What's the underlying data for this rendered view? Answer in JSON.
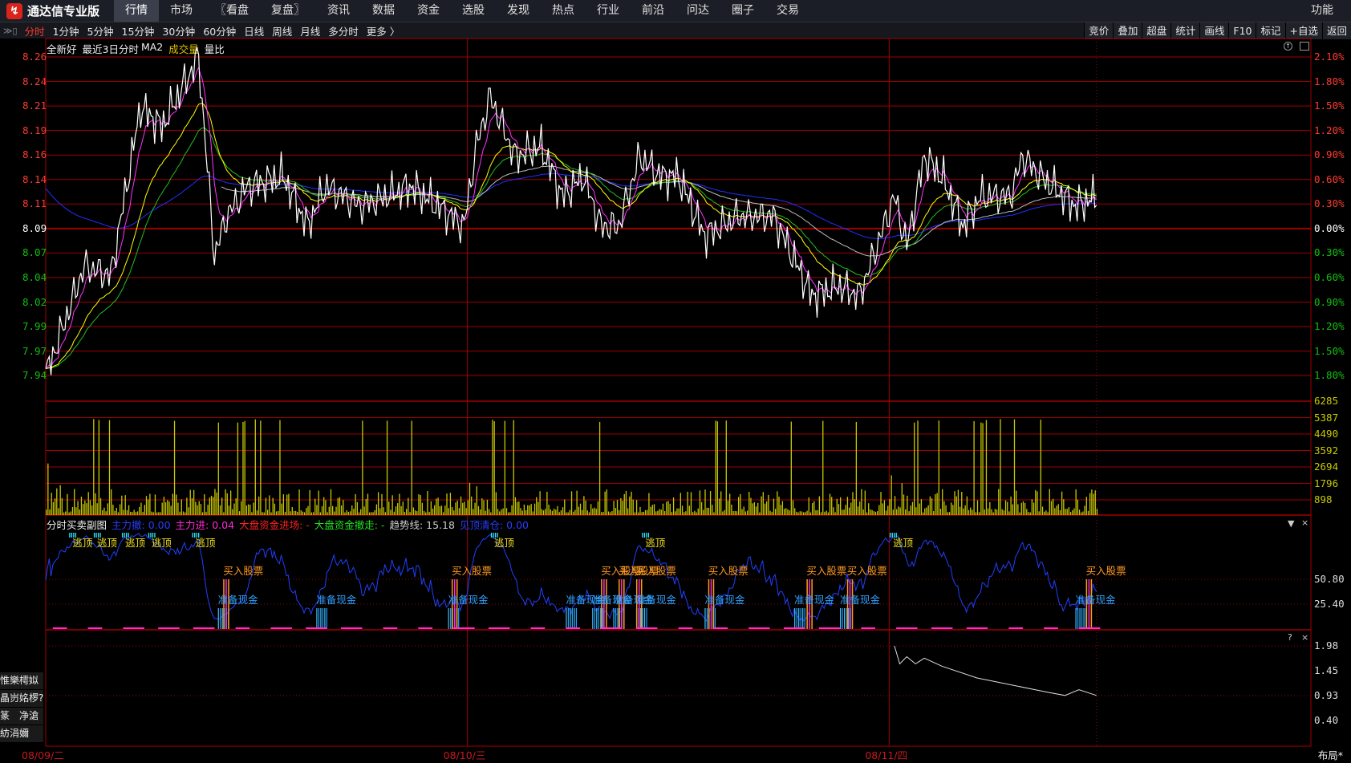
{
  "app": {
    "name": "通达信专业版",
    "logo_icon": "tdx-logo-icon"
  },
  "menu": {
    "items": [
      "行情",
      "市场",
      "〖看盘",
      "复盘〗",
      "资讯",
      "数据",
      "资金",
      "选股",
      "发现",
      "热点",
      "行业",
      "前沿",
      "问达",
      "圈子",
      "交易"
    ],
    "active": 0,
    "right": "功能"
  },
  "toolbar": {
    "timeframes": [
      "分时",
      "1分钟",
      "5分钟",
      "15分钟",
      "30分钟",
      "60分钟",
      "日线",
      "周线",
      "月线",
      "多分时",
      "更多 〉"
    ],
    "active": 0,
    "buttons": [
      "竞价",
      "叠加",
      "超盘",
      "统计",
      "画线",
      "F10",
      "标记",
      "+自选",
      "返回"
    ]
  },
  "info": {
    "stock": "全新好",
    "mode": "最近3日分时",
    "ma": "MA2",
    "volume": "成交量",
    "ratio": "量比"
  },
  "price_axis": {
    "left": [
      "8.26",
      "8.24",
      "8.21",
      "8.19",
      "8.16",
      "8.14",
      "8.11",
      "8.09",
      "8.07",
      "8.04",
      "8.02",
      "7.99",
      "7.97",
      "7.94"
    ],
    "right": [
      "2.10%",
      "1.80%",
      "1.50%",
      "1.20%",
      "0.90%",
      "0.60%",
      "0.30%",
      "0.00%",
      "0.30%",
      "0.60%",
      "0.90%",
      "1.20%",
      "1.50%",
      "1.80%"
    ],
    "prev_close": 8.09,
    "max": 8.26,
    "min": 7.94
  },
  "volume_axis": [
    "6285",
    "5387",
    "4490",
    "3592",
    "2694",
    "1796",
    "898"
  ],
  "indicator": {
    "title": "分时买卖副图",
    "fields": [
      {
        "label": "主力撤:",
        "value": "0.00",
        "color": "#2a3cff"
      },
      {
        "label": "主力进:",
        "value": "0.04",
        "color": "#ff2bd8"
      },
      {
        "label": "大盘资金进场:",
        "value": "-",
        "color": "#ff2020"
      },
      {
        "label": "大盘资金撤走:",
        "value": "-",
        "color": "#20e020"
      },
      {
        "label": "趋势线:",
        "value": "15.18",
        "color": "#cccccc"
      },
      {
        "label": "见顶清仓:",
        "value": "0.00",
        "color": "#2a3cff"
      }
    ],
    "axis": [
      "50.80",
      "25.40"
    ],
    "escape_label": "逃顶",
    "buy_label": "买入股票",
    "cash_label": "准备现金",
    "escape_t": [
      17,
      31,
      47,
      62,
      87,
      257,
      343,
      484
    ],
    "buy_t": [
      101,
      231,
      316,
      326,
      336,
      377,
      433,
      456,
      592
    ],
    "cash_t": [
      98,
      154,
      229,
      296,
      311,
      323,
      336,
      375,
      426,
      452,
      586
    ]
  },
  "lower_panel": {
    "axis": [
      "1.98",
      "1.45",
      "0.93",
      "0.40"
    ],
    "help": "?",
    "close": "×",
    "line": [
      [
        483,
        1.98
      ],
      [
        486,
        1.6
      ],
      [
        490,
        1.75
      ],
      [
        495,
        1.6
      ],
      [
        500,
        1.72
      ],
      [
        510,
        1.55
      ],
      [
        530,
        1.3
      ],
      [
        550,
        1.15
      ],
      [
        570,
        1.0
      ],
      [
        580,
        0.93
      ],
      [
        588,
        1.05
      ],
      [
        598,
        0.93
      ]
    ]
  },
  "panel_controls": {
    "menu": "▼",
    "close": "×"
  },
  "left_box": [
    "惟樂樗姒",
    "瞐岃姳椤?",
    "篆　净滄",
    "紡涓嬭"
  ],
  "dates": [
    "08/09/二",
    "08/10/三",
    "08/11/四"
  ],
  "layout_button": "布局*",
  "price_keypoints": [
    [
      0,
      7.94
    ],
    [
      22,
      8.05
    ],
    [
      37,
      8.04
    ],
    [
      54,
      8.21
    ],
    [
      66,
      8.19
    ],
    [
      87,
      8.26
    ],
    [
      96,
      8.06
    ],
    [
      103,
      8.1
    ],
    [
      115,
      8.13
    ],
    [
      135,
      8.14
    ],
    [
      149,
      8.09
    ],
    [
      159,
      8.13
    ],
    [
      179,
      8.11
    ],
    [
      208,
      8.13
    ],
    [
      238,
      8.09
    ],
    [
      245,
      8.17
    ],
    [
      253,
      8.22
    ],
    [
      267,
      8.16
    ],
    [
      282,
      8.17
    ],
    [
      294,
      8.12
    ],
    [
      306,
      8.14
    ],
    [
      316,
      8.09
    ],
    [
      326,
      8.09
    ],
    [
      338,
      8.16
    ],
    [
      350,
      8.14
    ],
    [
      360,
      8.14
    ],
    [
      375,
      8.08
    ],
    [
      394,
      8.1
    ],
    [
      414,
      8.1
    ],
    [
      436,
      8.02
    ],
    [
      451,
      8.03
    ],
    [
      463,
      8.02
    ],
    [
      483,
      8.12
    ],
    [
      490,
      8.07
    ],
    [
      500,
      8.16
    ],
    [
      510,
      8.14
    ],
    [
      522,
      8.09
    ],
    [
      532,
      8.12
    ],
    [
      549,
      8.12
    ],
    [
      556,
      8.16
    ],
    [
      566,
      8.14
    ],
    [
      586,
      8.11
    ],
    [
      598,
      8.12
    ]
  ],
  "colors": {
    "up": "#ff3b30",
    "down": "#10c010",
    "grid": "#a00000",
    "volume": "#c8c800",
    "price": "#ffffff",
    "avg": "#ffff00",
    "ma1": "#ff33ff",
    "ma2": "#20c020",
    "ma3": "#bbbbbb",
    "ma4": "#2030ff",
    "ind": "#2040ff"
  }
}
